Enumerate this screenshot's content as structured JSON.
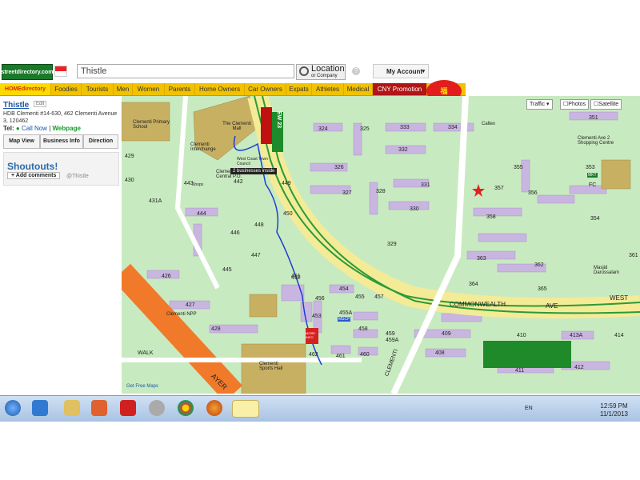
{
  "header": {
    "logo_text": "streetdirectory.com",
    "search_value": "Thistle",
    "location_label": "Location",
    "location_sub": "or Company",
    "help": "?",
    "account_label": "My Account"
  },
  "nav": {
    "home_label": "HOMEdirectory",
    "items": [
      "Foodies",
      "Tourists",
      "Men",
      "Women",
      "Parents",
      "Home Owners",
      "Car Owners",
      "Expats",
      "Athletes",
      "Medical"
    ],
    "cny_label": "CNY Promotion"
  },
  "panel": {
    "title": "Thistle",
    "edit_label": "Edit",
    "address": "HDB Clementi #14-630, 462 Clementi Avenue 3, 120462",
    "tel_label": "Tel:",
    "call_now": "Call Now",
    "separator": "|",
    "webpage": "Webpage",
    "buttons": [
      "Map View",
      "Business Info",
      "Direction"
    ],
    "shoutouts_title": "Shoutouts!",
    "add_comments": "+ Add comments",
    "handle": "@Thistle"
  },
  "map": {
    "tabs": [
      "Traffic",
      "Photos",
      "Satellite"
    ],
    "tooltip": "2 businesses inside",
    "labels": {
      "clementi_mall": "The Clementi Mall",
      "primary_school": "Clementi Primary School",
      "interchange": "Clementi Interchange",
      "post_office": "Clementi Central P.O.",
      "npp": "Clementi NPP",
      "sports_hall": "Clementi Sports Hall",
      "shopping_centre": "Clementi Ave 2 Shopping Centre",
      "darussalam": "Masjid Darussalam",
      "more_info": "MORE INFO",
      "caltex": "Caltex",
      "west_coast": "West Coast Town Council",
      "mrt": "EW 23",
      "road_commonwealth": "COMMONWEALTH",
      "road_ave": "AVE",
      "road_west": "WEST",
      "road_clementi": "CLEMENTI",
      "road_ayer": "AYER",
      "road_walk": "WALK",
      "get_free_maps": "Get Free Maps",
      "shops": "Shops",
      "mscp": "MSCP",
      "fc": "FC",
      "mkt": "MKT"
    },
    "blocks": [
      "324",
      "325",
      "333",
      "334",
      "351",
      "332",
      "326",
      "327",
      "328",
      "331",
      "355",
      "353",
      "357",
      "330",
      "356",
      "354",
      "329",
      "358",
      "363",
      "362",
      "364",
      "365",
      "361",
      "426",
      "427",
      "428",
      "429",
      "430",
      "431A",
      "443",
      "442",
      "444",
      "445",
      "446",
      "447",
      "448",
      "449",
      "450",
      "451",
      "452",
      "453",
      "454",
      "455",
      "455A",
      "456",
      "457",
      "458",
      "459",
      "459A",
      "460",
      "461",
      "462",
      "408",
      "409",
      "410",
      "411",
      "412",
      "413A",
      "414"
    ]
  },
  "taskbar": {
    "lang": "EN",
    "time": "12:59 PM",
    "date": "11/1/2013"
  }
}
